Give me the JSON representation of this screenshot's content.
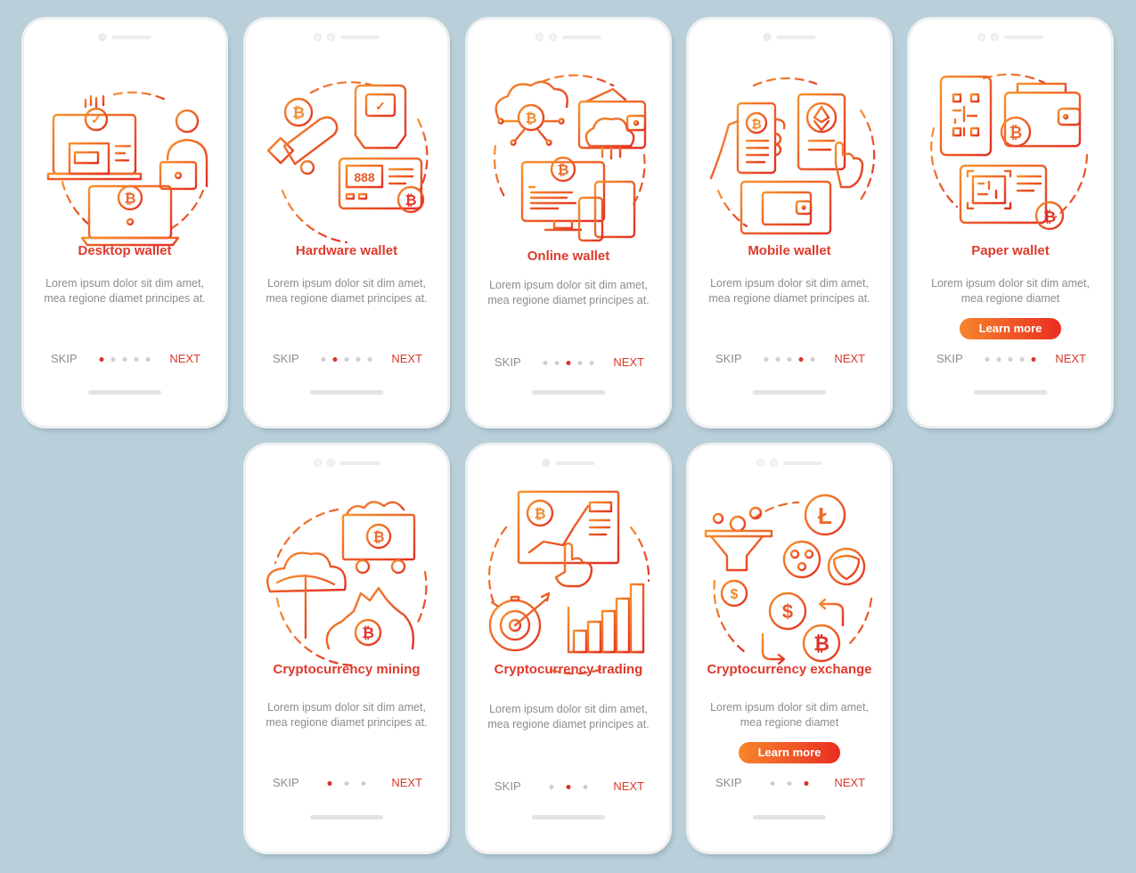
{
  "theme": {
    "background": "#b9cfd9",
    "title_color": "#de3a2c",
    "gradient_start": "#f7852c",
    "gradient_end": "#ea2d22",
    "body_text_color": "#8c8c8c",
    "active_dot_color": "#d8322a"
  },
  "screens": [
    {
      "title": "Desktop wallet",
      "description": "Lorem ipsum dolor sit dim amet, mea regione diamet principes at.",
      "illustration": "desktop-wallet-illustration",
      "skip_label": "SKIP",
      "next_label": "NEXT",
      "page_count": 5,
      "active_page": 1
    },
    {
      "title": "Hardware wallet",
      "description": "Lorem ipsum dolor sit dim amet, mea regione diamet principes at.",
      "illustration": "hardware-wallet-illustration",
      "skip_label": "SKIP",
      "next_label": "NEXT",
      "page_count": 5,
      "active_page": 2
    },
    {
      "title": "Online wallet",
      "description": "Lorem ipsum dolor sit dim amet, mea regione diamet principes at.",
      "illustration": "online-wallet-illustration",
      "skip_label": "SKIP",
      "next_label": "NEXT",
      "page_count": 5,
      "active_page": 3
    },
    {
      "title": "Mobile wallet",
      "description": "Lorem ipsum dolor sit dim amet, mea regione diamet principes at.",
      "illustration": "mobile-wallet-illustration",
      "skip_label": "SKIP",
      "next_label": "NEXT",
      "page_count": 5,
      "active_page": 4
    },
    {
      "title": "Paper wallet",
      "description": "Lorem ipsum dolor sit dim amet, mea regione diamet",
      "illustration": "paper-wallet-illustration",
      "button_label": "Learn more",
      "skip_label": "SKIP",
      "next_label": "NEXT",
      "page_count": 5,
      "active_page": 5
    },
    {
      "title": "Cryptocurrency mining",
      "description": "Lorem ipsum dolor sit dim amet, mea regione diamet principes at.",
      "illustration": "crypto-mining-illustration",
      "skip_label": "SKIP",
      "next_label": "NEXT",
      "page_count": 3,
      "active_page": 1
    },
    {
      "title": "Cryptocurrency trading",
      "description": "Lorem ipsum dolor sit dim amet, mea regione diamet principes at.",
      "illustration": "crypto-trading-illustration",
      "skip_label": "SKIP",
      "next_label": "NEXT",
      "page_count": 3,
      "active_page": 2
    },
    {
      "title": "Cryptocurrency exchange",
      "description": "Lorem ipsum dolor sit dim amet, mea regione diamet",
      "illustration": "crypto-exchange-illustration",
      "button_label": "Learn more",
      "skip_label": "SKIP",
      "next_label": "NEXT",
      "page_count": 3,
      "active_page": 3
    }
  ],
  "glyphs": {
    "bitcoin": "₿",
    "dollar": "$",
    "litecoin": "Ł",
    "check": "✓",
    "lcd_digits": "888"
  }
}
